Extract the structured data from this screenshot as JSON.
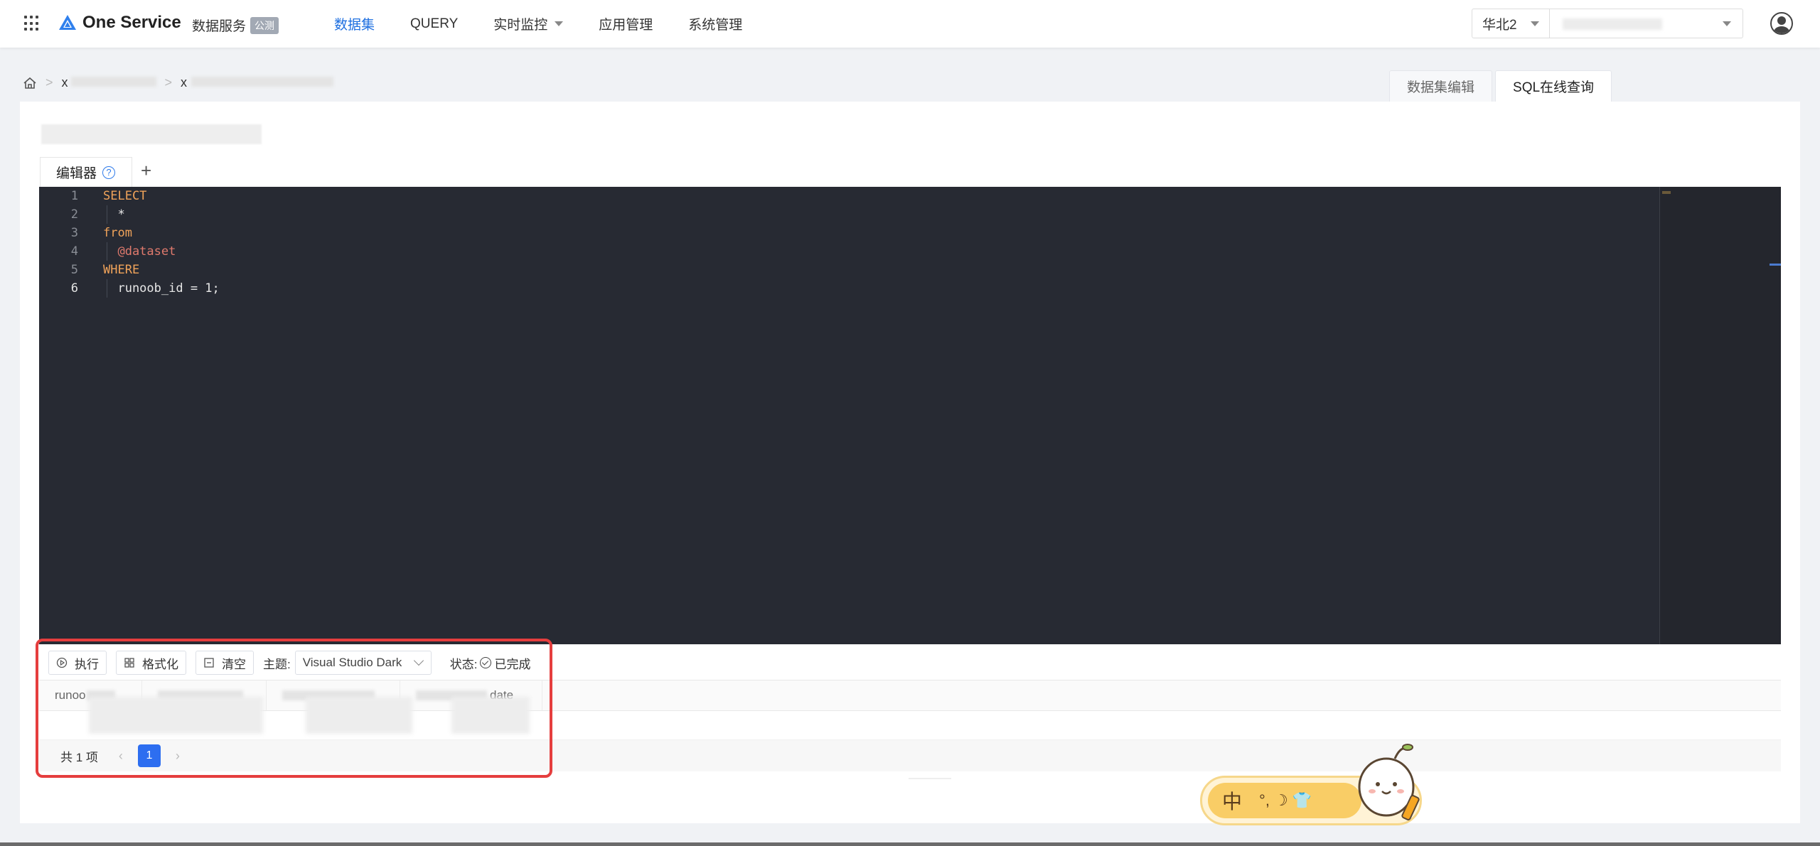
{
  "header": {
    "app_title": "One Service",
    "service_name": "数据服务",
    "service_badge": "公测",
    "nav": [
      {
        "label": "数据集",
        "active": true
      },
      {
        "label": "QUERY"
      },
      {
        "label": "实时监控",
        "has_dropdown": true
      },
      {
        "label": "应用管理"
      },
      {
        "label": "系统管理"
      }
    ],
    "region": "华北2"
  },
  "breadcrumb": {
    "item1": "x",
    "item2": "x"
  },
  "mode_tabs": [
    {
      "label": "数据集编辑"
    },
    {
      "label": "SQL在线查询",
      "active": true
    }
  ],
  "editor": {
    "tab_label": "编辑器",
    "help_glyph": "?",
    "add_glyph": "+",
    "lines": [
      {
        "num": "1",
        "text": "SELECT",
        "style": "kw"
      },
      {
        "num": "2",
        "text": "  *",
        "style": "plain"
      },
      {
        "num": "3",
        "text": "from",
        "style": "kw"
      },
      {
        "num": "4",
        "text": "  @dataset",
        "style": "var"
      },
      {
        "num": "5",
        "text": "WHERE",
        "style": "kw"
      },
      {
        "num": "6",
        "text": "  runoob_id = 1;",
        "style": "plain"
      }
    ]
  },
  "toolbar": {
    "run_label": "执行",
    "format_label": "格式化",
    "clear_label": "清空",
    "theme_label": "主题:",
    "theme_value": "Visual Studio Dark",
    "status_label": "状态:",
    "status_value": "已完成"
  },
  "results": {
    "columns": [
      "runoo",
      "date"
    ],
    "total_label": "共 1 项",
    "page": "1",
    "prev_glyph": "‹",
    "next_glyph": "›"
  },
  "ime": {
    "char": "中",
    "icons": "°,  ☽  👕"
  },
  "colors": {
    "accent": "#1e6fe0",
    "editor_bg": "#272a33",
    "keyword": "#f0a35a",
    "variable": "#e07a6d",
    "highlight_border": "#e53e3e",
    "page_active": "#2d6ef0"
  }
}
